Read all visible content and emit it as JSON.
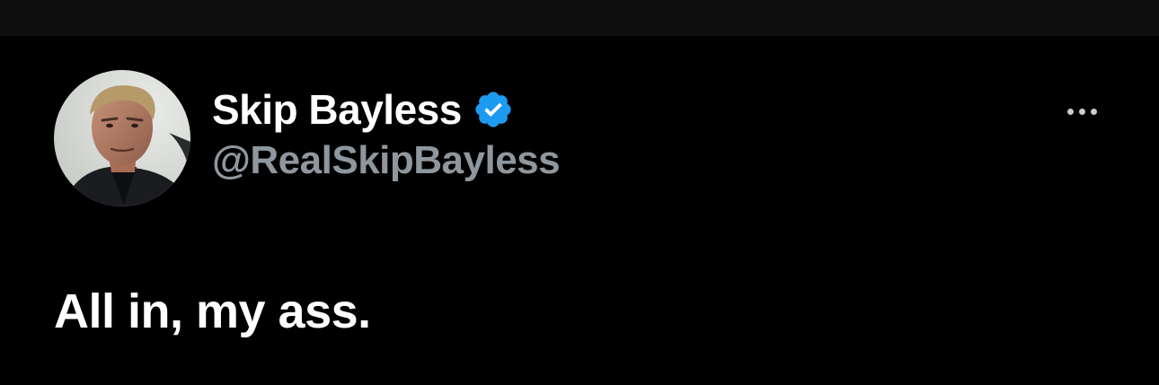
{
  "tweet": {
    "author": {
      "display_name": "Skip Bayless",
      "handle": "@RealSkipBayless",
      "verified": true,
      "verified_icon": "verified-badge-icon",
      "verified_color": "#1d9bf0"
    },
    "more_icon": "more-options-icon",
    "text": "All in, my ass."
  },
  "colors": {
    "background": "#000000",
    "top_bar": "#0f0f10",
    "primary_text": "#ffffff",
    "secondary_text": "#8f979e"
  }
}
